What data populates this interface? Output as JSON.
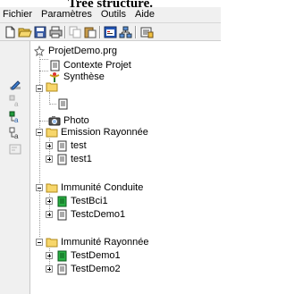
{
  "title": "Tree structure.",
  "menu": [
    "Fichier",
    "Paramètres",
    "Outils",
    "Aide"
  ],
  "toolbar_icons": [
    "new-file-icon",
    "open-folder-icon",
    "save-icon",
    "print-icon",
    "copy-icon",
    "paste-icon",
    "properties-icon",
    "network-icon",
    "settings-icon"
  ],
  "sidebar_icons": [
    "pencil-icon",
    "disabled-a-icon",
    "link-a-icon",
    "link-b-icon",
    "disabled-form-icon"
  ],
  "tree": {
    "root": "ProjetDemo.prg",
    "contexte": "Contexte Projet",
    "synthese": "Synthèse",
    "photo": "Photo",
    "emission": "Emission Rayonnée",
    "emission_items": [
      "test",
      "test1"
    ],
    "immunite_conduite": "Immunité Conduite",
    "immunite_conduite_items": [
      "TestBci1",
      "TestcDemo1"
    ],
    "immunite_rayonnee": "Immunité Rayonnée",
    "immunite_rayonnee_items": [
      "TestDemo1",
      "TestDemo2"
    ]
  }
}
